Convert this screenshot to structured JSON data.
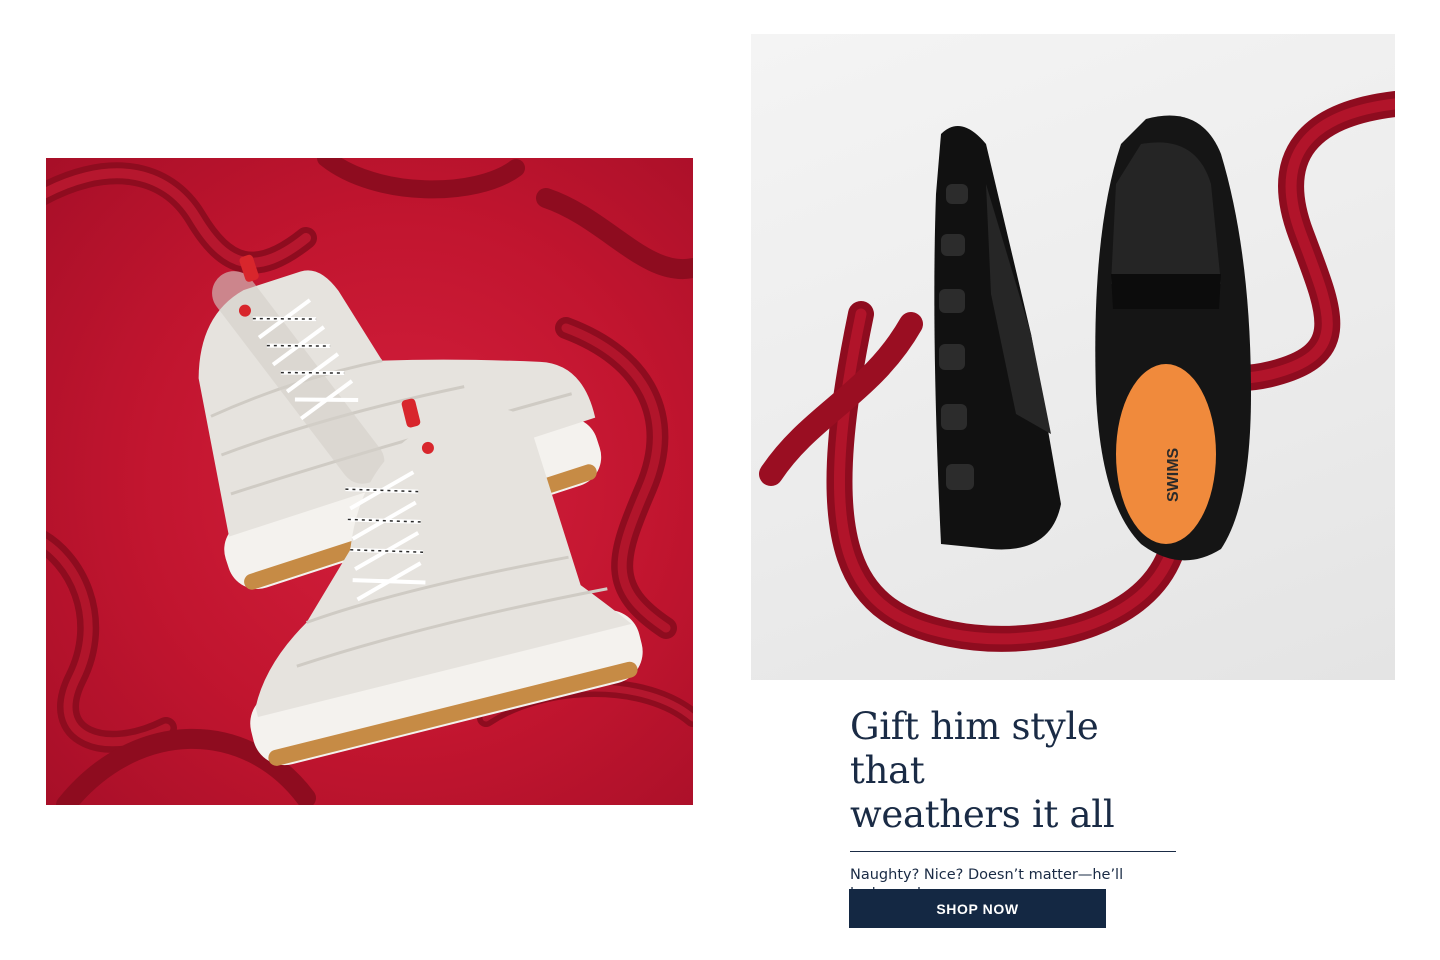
{
  "promo": {
    "headline_line1": "Gift him style that",
    "headline_line2": "weathers it all",
    "subcopy": "Naughty? Nice? Doesn’t matter—he’ll look good.",
    "cta_label": "SHOP NOW"
  },
  "images": {
    "left_alt": "White quilted high-top sneaker boots on red background with satin ribbon",
    "right_alt": "Black penny loafers with orange insole and red satin ribbon",
    "sole_logo": "SWIMS"
  },
  "colors": {
    "brand_navy": "#142843",
    "ribbon_red": "#9e0f23",
    "backdrop_red": "#c1152f",
    "insole_orange": "#f08a3c"
  }
}
